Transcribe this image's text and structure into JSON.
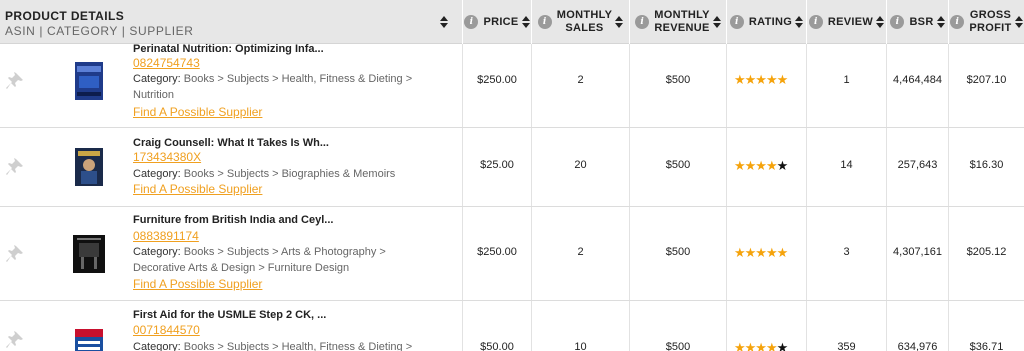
{
  "header": {
    "product_details": "PRODUCT DETAILS",
    "product_sub": "ASIN | CATEGORY | SUPPLIER",
    "price": "PRICE",
    "monthly_sales_1": "MONTHLY",
    "monthly_sales_2": "SALES",
    "monthly_revenue_1": "MONTHLY",
    "monthly_revenue_2": "REVENUE",
    "rating": "RATING",
    "review": "REVIEW",
    "bsr": "BSR",
    "gross_profit_1": "GROSS",
    "gross_profit_2": "PROFIT"
  },
  "colors": {
    "accent": "#f0a020",
    "star": "#f5a30c",
    "header_bg": "#e7e7e7"
  },
  "rows": [
    {
      "title": "Perinatal Nutrition: Optimizing Infa...",
      "asin": "0824754743",
      "category_label": "Category:",
      "category": "Books > Subjects > Health, Fitness & Dieting > Nutrition",
      "supplier": "Find A Possible Supplier",
      "price": "$250.00",
      "monthly_sales": "2",
      "monthly_revenue": "$500",
      "rating": 5,
      "review": "1",
      "bsr": "4,464,484",
      "gross_profit": "$207.10"
    },
    {
      "title": "Craig Counsell: What It Takes Is Wh...",
      "asin": "173434380X",
      "category_label": "Category:",
      "category": "Books > Subjects > Biographies & Memoirs",
      "supplier": "Find A Possible Supplier",
      "price": "$25.00",
      "monthly_sales": "20",
      "monthly_revenue": "$500",
      "rating": 4,
      "review": "14",
      "bsr": "257,643",
      "gross_profit": "$16.30"
    },
    {
      "title": "Furniture from British India and Ceyl...",
      "asin": "0883891174",
      "category_label": "Category:",
      "category": "Books > Subjects > Arts & Photography > Decorative Arts & Design > Furniture Design",
      "supplier": "Find A Possible Supplier",
      "price": "$250.00",
      "monthly_sales": "2",
      "monthly_revenue": "$500",
      "rating": 5,
      "review": "3",
      "bsr": "4,307,161",
      "gross_profit": "$205.12"
    },
    {
      "title": "First Aid for the USMLE Step 2 CK, ...",
      "asin": "0071844570",
      "category_label": "Category:",
      "category": "Books > Subjects > Health, Fitness & Dieting >",
      "supplier": "",
      "price": "$50.00",
      "monthly_sales": "10",
      "monthly_revenue": "$500",
      "rating": 4,
      "review": "359",
      "bsr": "634,976",
      "gross_profit": "$36.71"
    }
  ]
}
